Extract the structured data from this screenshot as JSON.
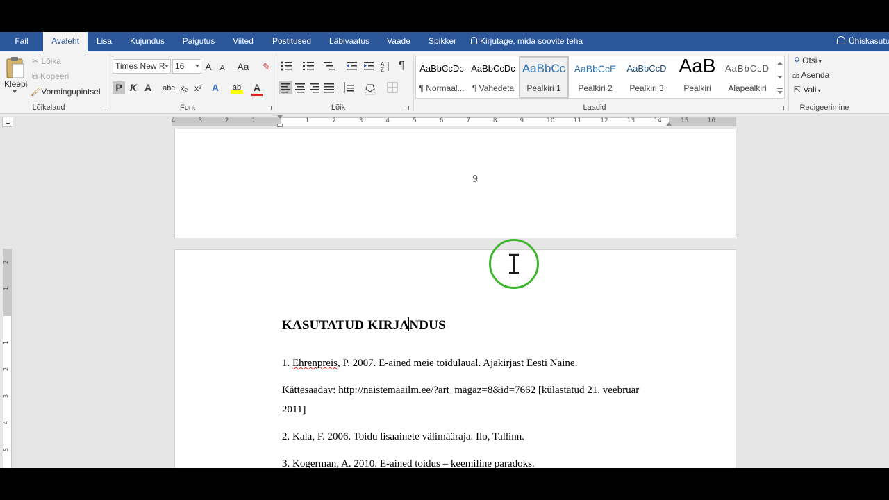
{
  "tabs": [
    {
      "label": "Fail",
      "active": false
    },
    {
      "label": "Avaleht",
      "active": true
    },
    {
      "label": "Lisa",
      "active": false
    },
    {
      "label": "Kujundus",
      "active": false
    },
    {
      "label": "Paigutus",
      "active": false
    },
    {
      "label": "Viited",
      "active": false
    },
    {
      "label": "Postitused",
      "active": false
    },
    {
      "label": "Läbivaatus",
      "active": false
    },
    {
      "label": "Vaade",
      "active": false
    },
    {
      "label": "Spikker",
      "active": false
    }
  ],
  "tell_me": "Kirjutage, mida soovite teha",
  "share": "Ühiskasutu",
  "clipboard": {
    "paste": "Kleebi",
    "cut": "Lõika",
    "copy": "Kopeeri",
    "format_painter": "Vormingupintsel",
    "group_label": "Lõikelaud"
  },
  "font": {
    "name": "Times New R",
    "size": "16",
    "group_label": "Font",
    "bold": "P",
    "italic": "K",
    "underline": "A",
    "strike": "abc",
    "subscript": "x₂",
    "superscript": "x²",
    "grow": "A",
    "shrink": "A",
    "case": "Aa",
    "effects": "A",
    "highlight": "ab",
    "color": "A"
  },
  "paragraph": {
    "group_label": "Lõik",
    "pilcrow": "¶"
  },
  "styles": {
    "group_label": "Laadid",
    "items": [
      {
        "sample": "AaBbCcDc",
        "label": "¶ Normaal..."
      },
      {
        "sample": "AaBbCcDc",
        "label": "¶ Vahedeta"
      },
      {
        "sample": "AaBbCc",
        "label": "Pealkiri 1"
      },
      {
        "sample": "AaBbCcE",
        "label": "Pealkiri 2"
      },
      {
        "sample": "AaBbCcD",
        "label": "Pealkiri 3"
      },
      {
        "sample": "AaB",
        "label": "Pealkiri"
      },
      {
        "sample": "AaBbCcD",
        "label": "Alapealkiri"
      }
    ]
  },
  "editing": {
    "find": "Otsi",
    "replace": "Asenda",
    "select": "Vali",
    "group_label": "Redigeerimine"
  },
  "ruler": {
    "h_labels": [
      "4",
      "3",
      "2",
      "1",
      "1",
      "2",
      "3",
      "4",
      "5",
      "6",
      "7",
      "8",
      "9",
      "10",
      "11",
      "12",
      "13",
      "14",
      "15",
      "16"
    ],
    "v_labels": [
      "2",
      "1",
      "1",
      "2",
      "3",
      "4",
      "5"
    ]
  },
  "document": {
    "page_number": "9",
    "heading": "KASUTATUD KIRJANDUS",
    "refs": [
      {
        "prefix": "1. ",
        "name": "Ehrenpreis",
        "rest": ", P. 2007. E-ained meie toidulaual. Ajakirjast Eesti Naine."
      },
      {
        "text": "Kättesaadav: http://naistemaailm.ee/?art_magaz=8&id=7662 [külastatud 21. veebruar"
      },
      {
        "text": "2011]"
      },
      {
        "text": "2. Kala, F. 2006. Toidu lisaainete välimääraja. Ilo, Tallinn."
      },
      {
        "prefix": "3. ",
        "name": "Kogerman",
        "rest": ", A. 2010. E-ained toidus – keemiline paradoks."
      }
    ]
  },
  "colors": {
    "tab_bar": "#2b579a",
    "ribbon": "#f3f3f3",
    "workspace": "#e6e6e6",
    "cursor_ring": "#3fb52f",
    "spell_underline": "#e02020"
  }
}
